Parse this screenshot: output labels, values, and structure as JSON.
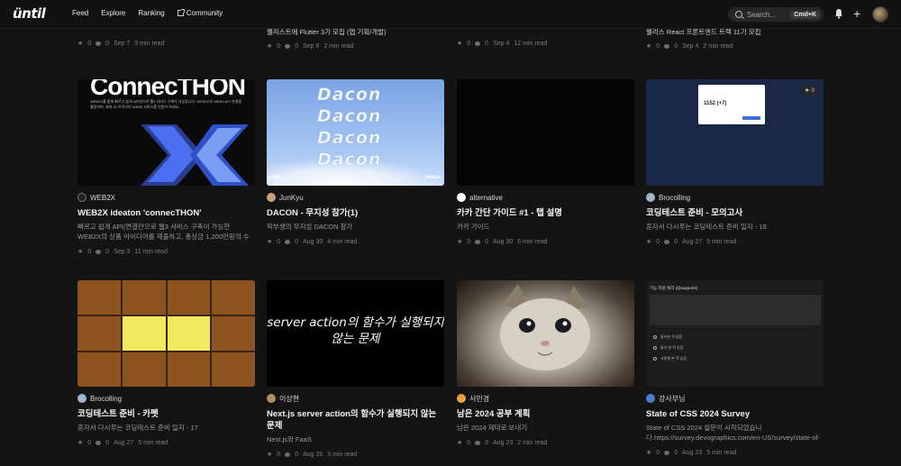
{
  "nav": {
    "logo": "üntil",
    "links": [
      "Feed",
      "Explore",
      "Ranking",
      "Community"
    ],
    "search_placeholder": "Search...",
    "search_shortcut": "Cmd+K"
  },
  "top_row": [
    {
      "title": "",
      "stars": "0",
      "comments": "0",
      "date": "Sep 7",
      "read": "5 min read"
    },
    {
      "title": "웰리스트에 Flutter 3기 모집 (앱 기획/개발)",
      "stars": "0",
      "comments": "0",
      "date": "Sep 6",
      "read": "2 min read"
    },
    {
      "title": "",
      "stars": "0",
      "comments": "0",
      "date": "Sep 4",
      "read": "12 min read"
    },
    {
      "title": "웰리스 React 프론트엔드 트랙 11기 모집",
      "stars": "0",
      "comments": "0",
      "date": "Sep 4",
      "read": "2 min read"
    }
  ],
  "cards": [
    {
      "author": "WEB2X",
      "title": "WEB2X ideaton 'connecTHON'",
      "desc": "빠르고 쉽게 API(연결만으로 웹3 서비스 구축이 가능한 WEB2X의 상품 아이디어를 제출하고, 총상금 1,200만원의 수익금...",
      "stars": "0",
      "comments": "0",
      "date": "Sep 3",
      "read": "11 min read",
      "thumb_text": "ConnecTHON",
      "thumb_sub": "WEB2X를 통해 빠르고 쉽게 API만으로 웹3 서비스 구축이 가능합니다. WEB2X의 WEB3 API 연결을 활용하여, 최대 30 아이디어 WEB3 서비스를 만들어 보세요."
    },
    {
      "author": "JunKyu",
      "title": "DACON - 무지성 참가(1)",
      "desc": "학부생의 무지성 DACON 참가",
      "stars": "0",
      "comments": "0",
      "date": "Aug 30",
      "read": "4 min read",
      "thumb_text": "Dacon",
      "thumb_left": "Until",
      "thumb_right": "JunKyu"
    },
    {
      "author": "alternative",
      "title": "카카 간단 가이드 #1 - 탭 설명",
      "desc": "카카 가이드",
      "stars": "0",
      "comments": "0",
      "date": "Aug 30",
      "read": "6 min read"
    },
    {
      "author": "Brocolling",
      "title": "코딩테스트 준비 - 모의고사",
      "desc": "혼자서 다시푸는 코딩테스트 준비 일지 - 18",
      "stars": "0",
      "comments": "0",
      "date": "Aug 27",
      "read": "5 min read",
      "thumb_score": "1152 (+7)",
      "bookmark": "0"
    },
    {
      "author": "Brocolling",
      "title": "코딩테스트 준비 - 카펫",
      "desc": "혼자서 다시푸는 코딩테스트 준비 일지 - 17",
      "stars": "0",
      "comments": "0",
      "date": "Aug 27",
      "read": "5 min read"
    },
    {
      "author": "이상현",
      "title": "Next.js server action의 함수가 실행되지 않는 문제",
      "desc": "Next.js와 FaaS",
      "stars": "0",
      "comments": "0",
      "date": "Aug 26",
      "read": "3 min read",
      "thumb_text": "server action의 함수가 실행되지 않는 문제"
    },
    {
      "author": "서민경",
      "title": "남은 2024 공부 계획",
      "desc": "남은 2024 제대로 보내기",
      "stars": "0",
      "comments": "0",
      "date": "Aug 23",
      "read": "2 min read"
    },
    {
      "author": "강사부님",
      "title": "State of CSS 2024 Survey",
      "desc": "State of CSS 2024 설문이 시작되었습니다.https://survey.devographics.com/en-US/survey/state-of-css/2024...",
      "stars": "0",
      "comments": "0",
      "date": "Aug 23",
      "read": "5 min read",
      "thumb_head": "기능 지원 쿼리 (@supports)",
      "thumb_opts": [
        "들어본 적 없음",
        "들어 본 적 있음",
        "사용해 본 적 있음"
      ]
    }
  ]
}
